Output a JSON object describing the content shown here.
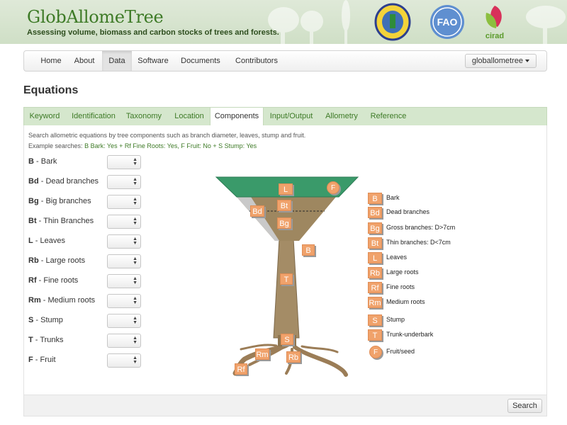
{
  "header": {
    "title": "GlobAllomeTree",
    "tagline": "Assessing volume, biomass and carbon stocks of trees and forests.",
    "logos": {
      "fao_text": "FAO",
      "cirad_text": "cirad"
    }
  },
  "nav": {
    "items": [
      {
        "label": "Home"
      },
      {
        "label": "About"
      },
      {
        "label": "Data",
        "active": true
      },
      {
        "label": "Software"
      },
      {
        "label": "Documents"
      },
      {
        "label": "Contributors"
      }
    ],
    "user_menu": "globallometree"
  },
  "page_title": "Equations",
  "tabs": [
    {
      "label": "Keyword"
    },
    {
      "label": "Identification"
    },
    {
      "label": "Taxonomy"
    },
    {
      "label": "Location"
    },
    {
      "label": "Components",
      "active": true
    },
    {
      "label": "Input/Output"
    },
    {
      "label": "Allometry"
    },
    {
      "label": "Reference"
    }
  ],
  "components_panel": {
    "description": "Search allometric equations by tree components such as branch diameter, leaves, stump and fruit.",
    "examples_label": "Example searches:",
    "examples_text": "B Bark: Yes + Rf Fine Roots: Yes, F Fruit: No + S Stump: Yes",
    "rows": [
      {
        "code": "B",
        "name": "- Bark",
        "value": ""
      },
      {
        "code": "Bd",
        "name": "- Dead branches",
        "value": ""
      },
      {
        "code": "Bg",
        "name": "- Big branches",
        "value": ""
      },
      {
        "code": "Bt",
        "name": "- Thin Branches",
        "value": ""
      },
      {
        "code": "L",
        "name": "- Leaves",
        "value": ""
      },
      {
        "code": "Rb",
        "name": "- Large roots",
        "value": ""
      },
      {
        "code": "Rf",
        "name": "- Fine roots",
        "value": ""
      },
      {
        "code": "Rm",
        "name": "- Medium roots",
        "value": ""
      },
      {
        "code": "S",
        "name": "- Stump",
        "value": ""
      },
      {
        "code": "T",
        "name": "- Trunks",
        "value": ""
      },
      {
        "code": "F",
        "name": "- Fruit",
        "value": ""
      }
    ]
  },
  "diagram": {
    "tags": {
      "L": "L",
      "F": "F",
      "Bt": "Bt",
      "Bd": "Bd",
      "Bg": "Bg",
      "B": "B",
      "T": "T",
      "S": "S",
      "Rm": "Rm",
      "Rb": "Rb",
      "Rf": "Rf"
    }
  },
  "legend": [
    {
      "code": "B",
      "label": "Bark"
    },
    {
      "code": "Bd",
      "label": "Dead branches"
    },
    {
      "code": "Bg",
      "label": "Gross branches: D>7cm"
    },
    {
      "code": "Bt",
      "label": "Thin branches: D<7cm"
    },
    {
      "code": "L",
      "label": "Leaves"
    },
    {
      "code": "Rb",
      "label": "Large roots"
    },
    {
      "code": "Rf",
      "label": "Fine roots"
    },
    {
      "code": "Rm",
      "label": "Medium roots"
    },
    {
      "code": "S",
      "label": "Stump"
    },
    {
      "code": "T",
      "label": "Trunk-underbark"
    },
    {
      "code": "F",
      "label": "Fruit/seed",
      "round": true
    }
  ],
  "search_button": "Search",
  "colors": {
    "brand_green": "#3d7a26",
    "tag_orange": "#f0a26b",
    "crown_green": "#3a9a6a",
    "trunk_brown": "#a48c66"
  }
}
